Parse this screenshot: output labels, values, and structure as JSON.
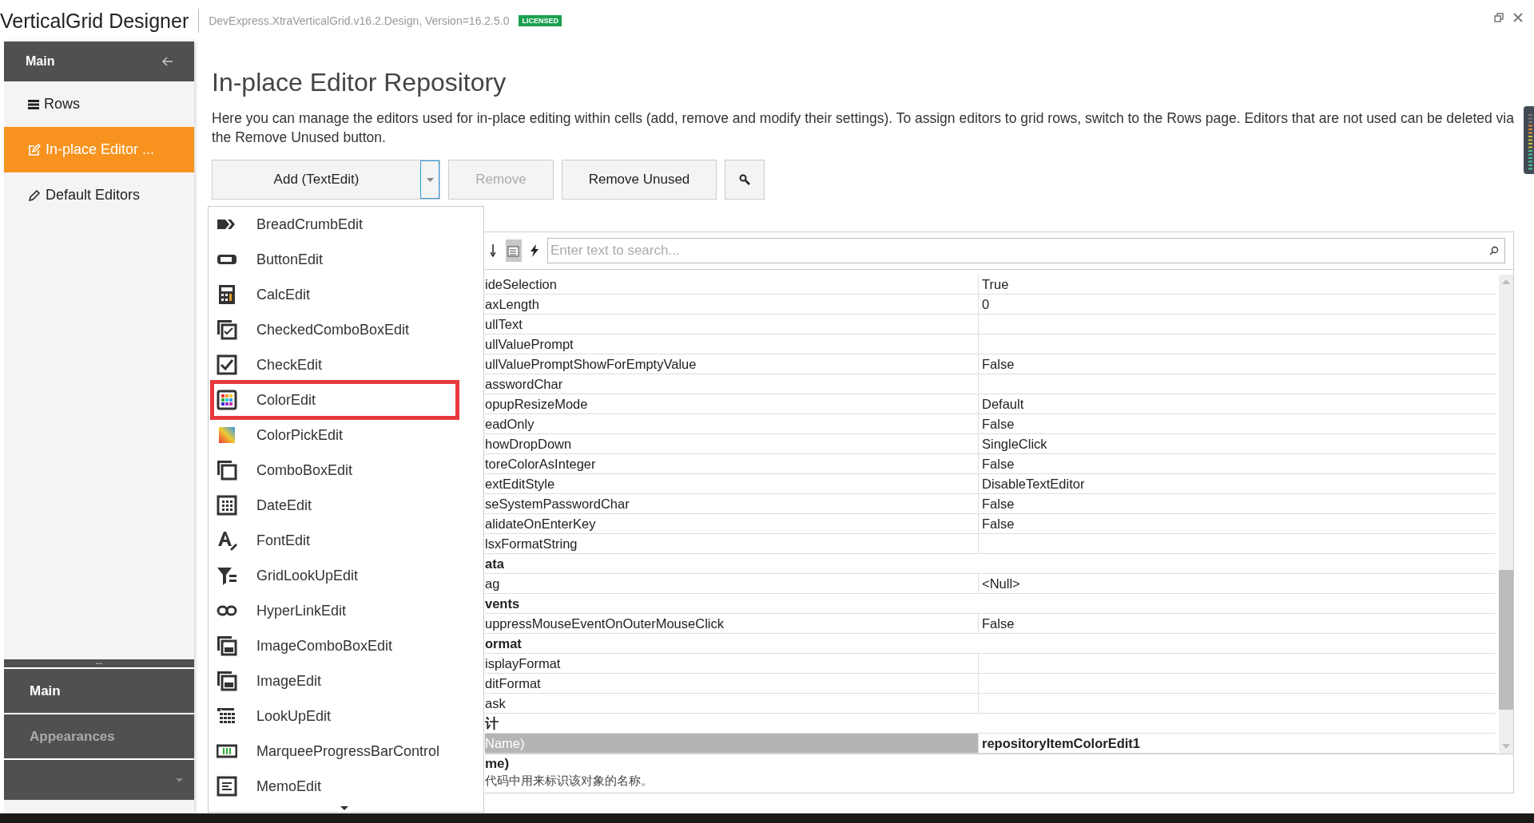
{
  "window": {
    "title": "VerticalGrid Designer",
    "subtitle": "DevExpress.XtraVerticalGrid.v16.2.Design, Version=16.2.5.0",
    "badge": "LICENSED"
  },
  "sidebar": {
    "header": "Main",
    "items": [
      {
        "label": "Rows",
        "selected": false
      },
      {
        "label": "In-place Editor ...",
        "selected": true
      },
      {
        "label": "Default Editors",
        "selected": false
      }
    ],
    "more": "...",
    "groups": [
      {
        "label": "Main",
        "selected": true
      },
      {
        "label": "Appearances",
        "selected": false
      }
    ]
  },
  "page": {
    "title": "In-place Editor Repository",
    "description": "Here you can manage the editors used for in-place editing within cells (add, remove and modify their settings). To assign editors to grid rows, switch to the Rows page. Editors that are not used can be deleted via the Remove Unused button."
  },
  "toolbar": {
    "add_button": "Add (TextEdit)",
    "buttons": [
      {
        "label": "Remove",
        "disabled": true
      },
      {
        "label": "Remove Unused",
        "disabled": false
      }
    ]
  },
  "dropdown": {
    "items": [
      {
        "label": "BreadCrumbEdit",
        "highlighted": false
      },
      {
        "label": "ButtonEdit",
        "highlighted": false
      },
      {
        "label": "CalcEdit",
        "highlighted": false
      },
      {
        "label": "CheckedComboBoxEdit",
        "highlighted": false
      },
      {
        "label": "CheckEdit",
        "highlighted": false
      },
      {
        "label": "ColorEdit",
        "highlighted": true
      },
      {
        "label": "ColorPickEdit",
        "highlighted": false
      },
      {
        "label": "ComboBoxEdit",
        "highlighted": false
      },
      {
        "label": "DateEdit",
        "highlighted": false
      },
      {
        "label": "FontEdit",
        "highlighted": false
      },
      {
        "label": "GridLookUpEdit",
        "highlighted": false
      },
      {
        "label": "HyperLinkEdit",
        "highlighted": false
      },
      {
        "label": "ImageComboBoxEdit",
        "highlighted": false
      },
      {
        "label": "ImageEdit",
        "highlighted": false
      },
      {
        "label": "LookUpEdit",
        "highlighted": false
      },
      {
        "label": "MarqueeProgressBarControl",
        "highlighted": false
      },
      {
        "label": "MemoEdit",
        "highlighted": false
      }
    ]
  },
  "property_grid": {
    "search": {
      "placeholder": "Enter text to search..."
    },
    "rows": [
      {
        "kind": "property",
        "name": "ideSelection",
        "value": "True",
        "selected": false
      },
      {
        "kind": "property",
        "name": "axLength",
        "value": "0",
        "selected": false
      },
      {
        "kind": "property",
        "name": "ullText",
        "selected": false
      },
      {
        "kind": "property",
        "name": "ullValuePrompt",
        "selected": false
      },
      {
        "kind": "property",
        "name": "ullValuePromptShowForEmptyValue",
        "value": "False",
        "selected": false
      },
      {
        "kind": "property",
        "name": "asswordChar",
        "selected": false
      },
      {
        "kind": "property",
        "name": "opupResizeMode",
        "value": "Default",
        "selected": false
      },
      {
        "kind": "property",
        "name": "eadOnly",
        "value": "False",
        "selected": false
      },
      {
        "kind": "property",
        "name": "howDropDown",
        "value": "SingleClick",
        "selected": false
      },
      {
        "kind": "property",
        "name": "toreColorAsInteger",
        "value": "False",
        "selected": false
      },
      {
        "kind": "property",
        "name": "extEditStyle",
        "value": "DisableTextEditor",
        "selected": false
      },
      {
        "kind": "property",
        "name": "seSystemPasswordChar",
        "value": "False",
        "selected": false
      },
      {
        "kind": "property",
        "name": "alidateOnEnterKey",
        "value": "False",
        "selected": false
      },
      {
        "kind": "property",
        "name": "lsxFormatString",
        "selected": false
      },
      {
        "kind": "category",
        "name": "ata",
        "selected": false
      },
      {
        "kind": "property",
        "name": "ag",
        "value": "<Null>",
        "selected": false
      },
      {
        "kind": "category",
        "name": "vents",
        "selected": false
      },
      {
        "kind": "property",
        "name": "uppressMouseEventOnOuterMouseClick",
        "value": "False",
        "selected": false
      },
      {
        "kind": "category",
        "name": "ormat",
        "selected": false
      },
      {
        "kind": "property",
        "name": "isplayFormat",
        "selected": false
      },
      {
        "kind": "property",
        "name": "ditFormat",
        "selected": false
      },
      {
        "kind": "property",
        "name": "ask",
        "selected": false
      },
      {
        "kind": "category",
        "name": "计",
        "selected": false
      },
      {
        "kind": "property",
        "name": "Name)",
        "value": "repositoryItemColorEdit1",
        "selected": true
      }
    ],
    "description": {
      "title": "me)",
      "text": "代码中用来标识该对象的名称。"
    }
  }
}
